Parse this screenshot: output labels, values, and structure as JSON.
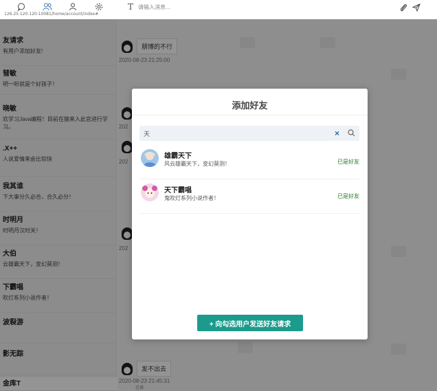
{
  "topbar": {
    "url": "126.25.120.120:10081/home/account/index#",
    "composer_placeholder": "请输入消息...",
    "composer_icon": "T",
    "icons": [
      "chat-icon",
      "contacts-icon",
      "profile-icon",
      "gear-icon",
      "paperclip-icon",
      "send-icon"
    ]
  },
  "contacts": [
    {
      "name": "友请求",
      "msg": "有用户添加好友!"
    },
    {
      "name": "彗敏",
      "msg": "明一听就是个好孩子！"
    },
    {
      "name": "晓敏",
      "msg": "欢学习Java编程！目前在猿来入此官进行学习。"
    },
    {
      "name": ".X++",
      "msg": "人说爱情来会比较快"
    },
    {
      "name": "我其谁",
      "msg": "下大事分久必合，合久必分！"
    },
    {
      "name": "时明月",
      "msg": "时明月汉时关！"
    },
    {
      "name": "大伯",
      "msg": "云雄霸天下，变幻莫测！"
    },
    {
      "name": "下霸唱",
      "msg": "吹灯系列小说作者！"
    },
    {
      "name": "波裂游",
      "msg": ""
    },
    {
      "name": "影无踪",
      "msg": ""
    },
    {
      "name": "金库T",
      "msg": ""
    }
  ],
  "chat": {
    "msg1": "朋博的不行",
    "time1": "2020-08-23 21:25:00",
    "lead1": "202",
    "lead2": "202",
    "lead3": "202",
    "msg2": "发不出去",
    "time2": "2020-08-23 21:45:31",
    "footer_text": "已读"
  },
  "modal": {
    "title": "添加好友",
    "search_value": "天",
    "clear_label": "×",
    "results": [
      {
        "name": "雄霸天下",
        "msg": "风云雄霸天下，变幻莫测！",
        "status": "已是好友"
      },
      {
        "name": "天下霸唱",
        "msg": "鬼吹灯系列小说作者！",
        "status": "已是好友"
      }
    ],
    "send_button": "+ 向勾选用户发送好友请求"
  },
  "colors": {
    "accent": "#1c9a8c",
    "status_green": "#2a7a2a",
    "overlay": "rgba(0,0,0,0.42)"
  }
}
